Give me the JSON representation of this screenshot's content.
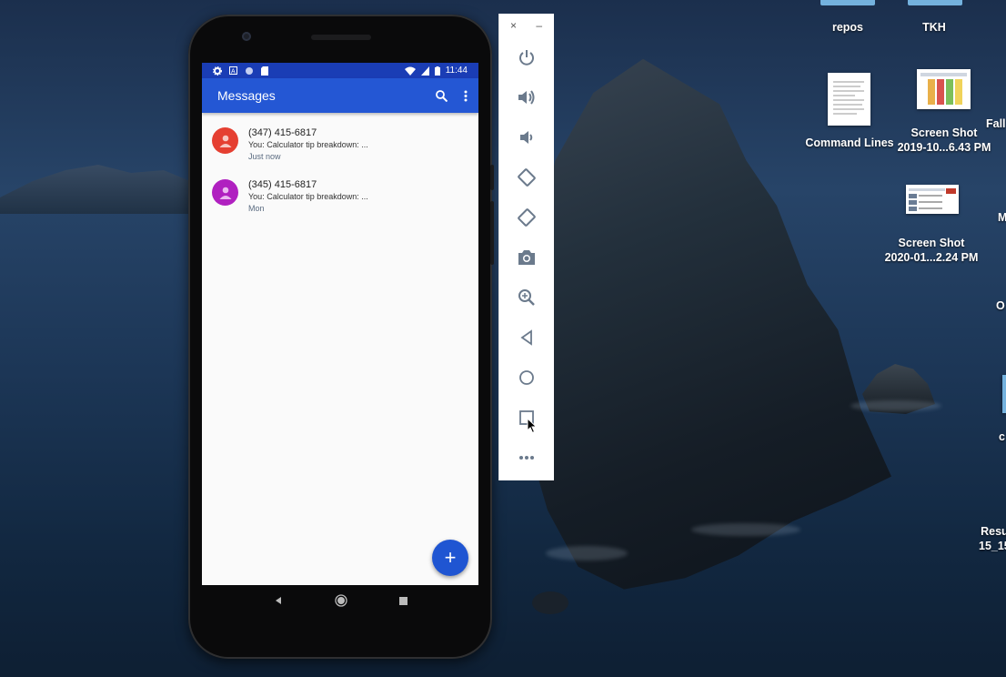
{
  "desktop": {
    "icons": [
      {
        "label": "repos"
      },
      {
        "label": "TKH"
      },
      {
        "label": "Command Lines"
      },
      {
        "label_line1": "Screen Shot",
        "label_line2": "2019-10...6.43 PM"
      },
      {
        "label_line1": "Screen Shot",
        "label_line2": "2020-01...2.24 PM"
      }
    ],
    "edge_labels": [
      "Fall",
      "M",
      "O",
      "c",
      "Resu",
      "15_15"
    ]
  },
  "phone": {
    "status_bar": {
      "time": "11:44"
    },
    "app_bar": {
      "title": "Messages",
      "icons": [
        "search-icon",
        "more-vert-icon"
      ]
    },
    "conversations": [
      {
        "name": "(347) 415-6817",
        "snippet": "You: Calculator tip breakdown: ...",
        "time": "Just now",
        "avatar_color": "#e53f31"
      },
      {
        "name": "(345) 415-6817",
        "snippet": "You: Calculator tip breakdown: ...",
        "time": "Mon",
        "avatar_color": "#b020c0"
      }
    ],
    "fab": {
      "label": "+"
    },
    "nav": [
      "back-icon",
      "home-icon",
      "overview-icon"
    ]
  },
  "emulator_toolbar": {
    "close_label": "×",
    "minimize_label": "–",
    "buttons": [
      "power-icon",
      "volume-up-icon",
      "volume-down-icon",
      "rotate-left-icon",
      "rotate-right-icon",
      "camera-icon",
      "zoom-icon",
      "back-icon",
      "home-icon",
      "overview-icon",
      "more-icon"
    ],
    "icon_color": "#6b7a8c"
  },
  "colors": {
    "app_bar": "#2457d4",
    "status_bar": "#1a3db5",
    "fab": "#1f55d2"
  }
}
